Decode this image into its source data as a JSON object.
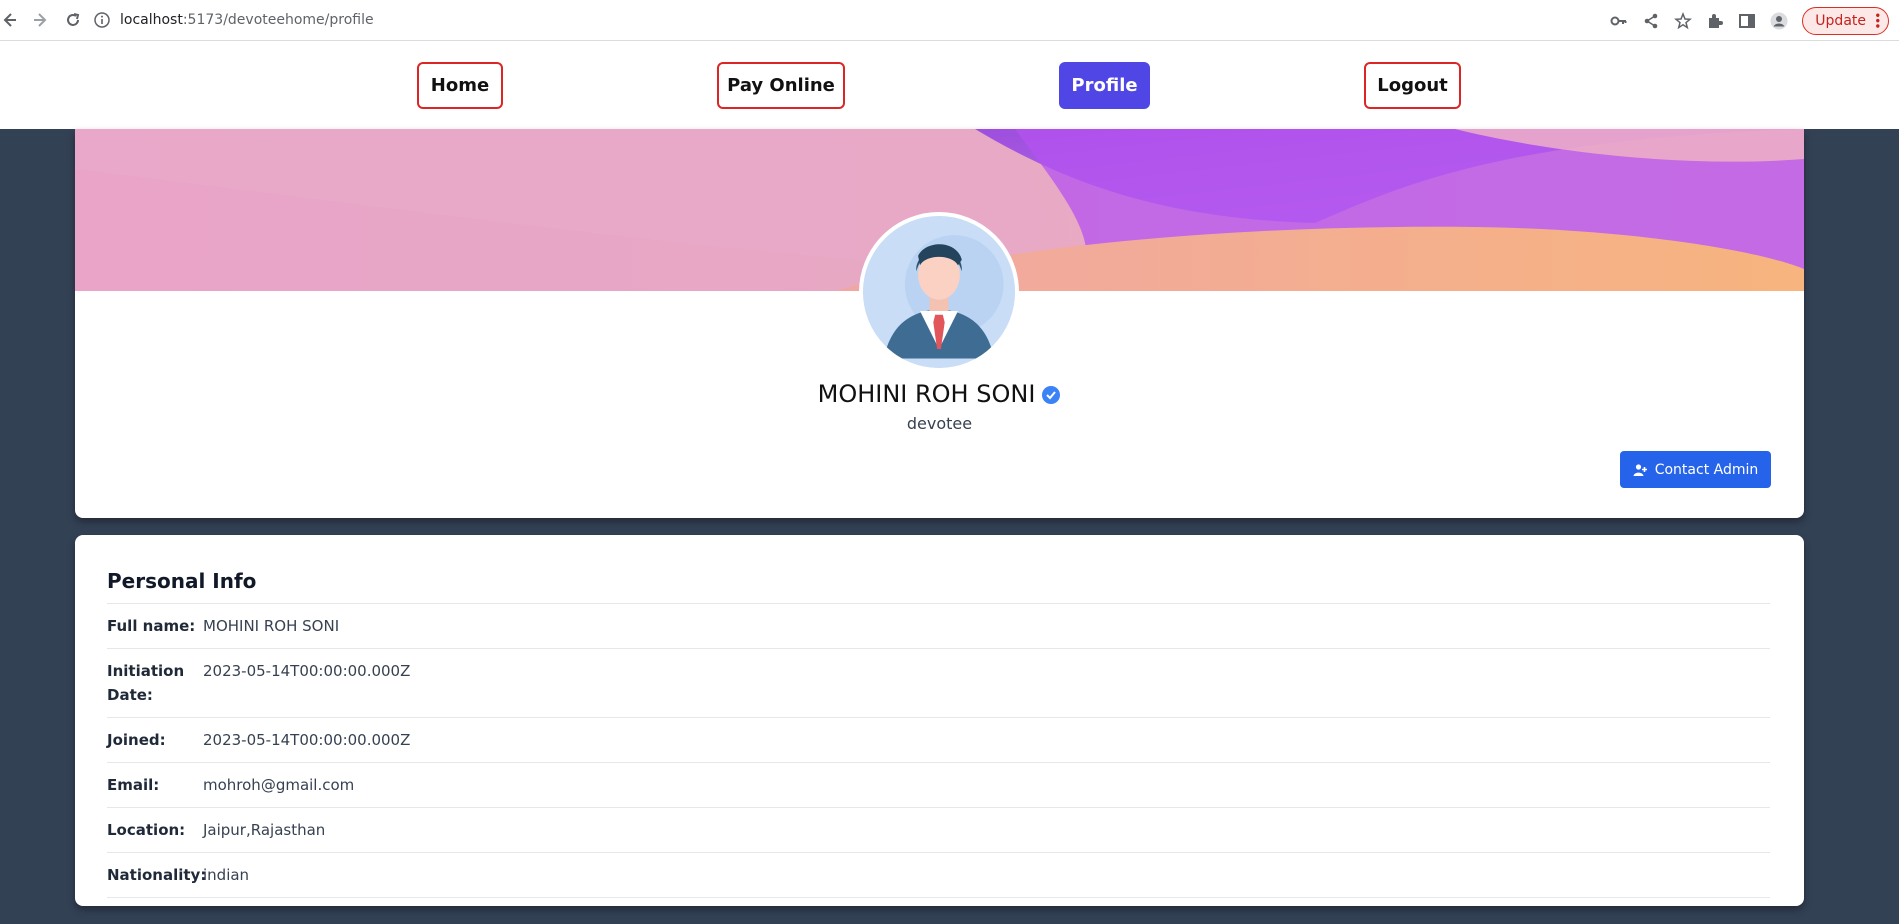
{
  "browser": {
    "url_host": "localhost",
    "url_path": ":5173/devoteehome/profile",
    "update_label": "Update"
  },
  "nav": {
    "home": "Home",
    "pay_online": "Pay Online",
    "profile": "Profile",
    "logout": "Logout"
  },
  "profile": {
    "name": "MOHINI ROH SONI",
    "role": "devotee",
    "contact_label": "Contact Admin"
  },
  "info": {
    "title": "Personal Info",
    "rows": [
      {
        "label": "Full name:",
        "value": "MOHINI ROH SONI"
      },
      {
        "label": "Initiation Date:",
        "value": "2023-05-14T00:00:00.000Z"
      },
      {
        "label": "Joined:",
        "value": "2023-05-14T00:00:00.000Z"
      },
      {
        "label": "Email:",
        "value": "mohroh@gmail.com"
      },
      {
        "label": "Location:",
        "value": "Jaipur,Rajasthan"
      },
      {
        "label": "Nationality:",
        "value": "indian"
      }
    ]
  },
  "colors": {
    "page_bg": "#334155",
    "active_nav": "#4f46e5",
    "nav_border": "#dc2626",
    "contact_btn": "#2563eb"
  }
}
